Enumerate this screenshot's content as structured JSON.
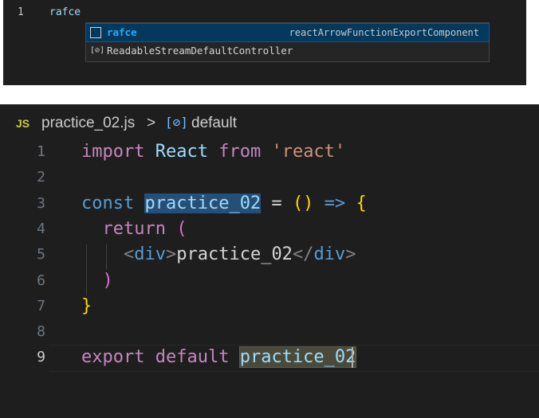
{
  "top_editor": {
    "line_number": "1",
    "typed_text": "rafce",
    "suggestions": [
      {
        "icon": "snippet-icon",
        "label_match": "rafce",
        "label_rest": "",
        "detail": "reactArrowFunctionExportComponent",
        "selected": true
      },
      {
        "icon": "symbol-class-icon",
        "label_match": "",
        "label_rest": "ReadableStreamDefaultController",
        "detail": "",
        "selected": false
      }
    ]
  },
  "breadcrumb": {
    "language_badge": "JS",
    "file_name": "practice_02.js",
    "separator": ">",
    "symbol_icon": "[⊘]",
    "symbol_name": "default"
  },
  "code_lines": [
    {
      "n": "1",
      "tokens": [
        [
          "kw2",
          "import"
        ],
        [
          "txt",
          " "
        ],
        [
          "id",
          "React"
        ],
        [
          "txt",
          " "
        ],
        [
          "kw2",
          "from"
        ],
        [
          "txt",
          " "
        ],
        [
          "str",
          "'react'"
        ]
      ]
    },
    {
      "n": "2",
      "tokens": []
    },
    {
      "n": "3",
      "tokens": [
        [
          "kw",
          "const"
        ],
        [
          "txt",
          " "
        ],
        [
          "id hl-word",
          "practice_02"
        ],
        [
          "txt",
          " = "
        ],
        [
          "br1",
          "()"
        ],
        [
          "txt",
          " "
        ],
        [
          "kw",
          "=>"
        ],
        [
          "txt",
          " "
        ],
        [
          "br1",
          "{"
        ]
      ]
    },
    {
      "n": "4",
      "tokens": [
        [
          "txt",
          "  "
        ],
        [
          "kw2",
          "return"
        ],
        [
          "txt",
          " "
        ],
        [
          "br2",
          "("
        ]
      ]
    },
    {
      "n": "5",
      "tokens": [
        [
          "txt",
          "    "
        ],
        [
          "tagb",
          "<"
        ],
        [
          "tag",
          "div"
        ],
        [
          "tagb",
          ">"
        ],
        [
          "txt",
          "practice_02"
        ],
        [
          "tagb",
          "</"
        ],
        [
          "tag",
          "div"
        ],
        [
          "tagb",
          ">"
        ]
      ]
    },
    {
      "n": "6",
      "tokens": [
        [
          "txt",
          "  "
        ],
        [
          "br2",
          ")"
        ]
      ]
    },
    {
      "n": "7",
      "tokens": [
        [
          "br1",
          "}"
        ]
      ]
    },
    {
      "n": "8",
      "tokens": []
    },
    {
      "n": "9",
      "tokens": [
        [
          "kw2",
          "export"
        ],
        [
          "txt",
          " "
        ],
        [
          "kw2",
          "default"
        ],
        [
          "txt",
          " "
        ],
        [
          "id hl-word2",
          "practice_02"
        ]
      ]
    }
  ],
  "current_line": "9"
}
